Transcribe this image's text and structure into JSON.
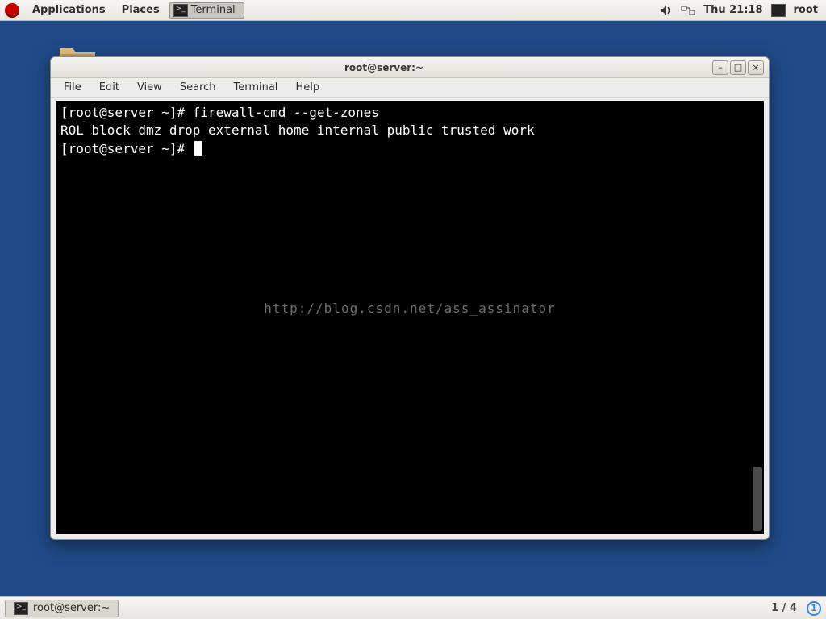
{
  "top": {
    "applications": "Applications",
    "places": "Places",
    "task_label": "Terminal",
    "clock": "Thu 21:18",
    "user": "root"
  },
  "window": {
    "title": "root@server:~",
    "menus": [
      "File",
      "Edit",
      "View",
      "Search",
      "Terminal",
      "Help"
    ]
  },
  "terminal": {
    "lines": [
      "[root@server ~]# firewall-cmd --get-zones",
      "ROL block dmz drop external home internal public trusted work",
      "[root@server ~]# "
    ],
    "watermark": "http://blog.csdn.net/ass_assinator"
  },
  "bottom": {
    "task_label": "root@server:~",
    "workspace": "1 / 4",
    "workspace_current": "1"
  }
}
